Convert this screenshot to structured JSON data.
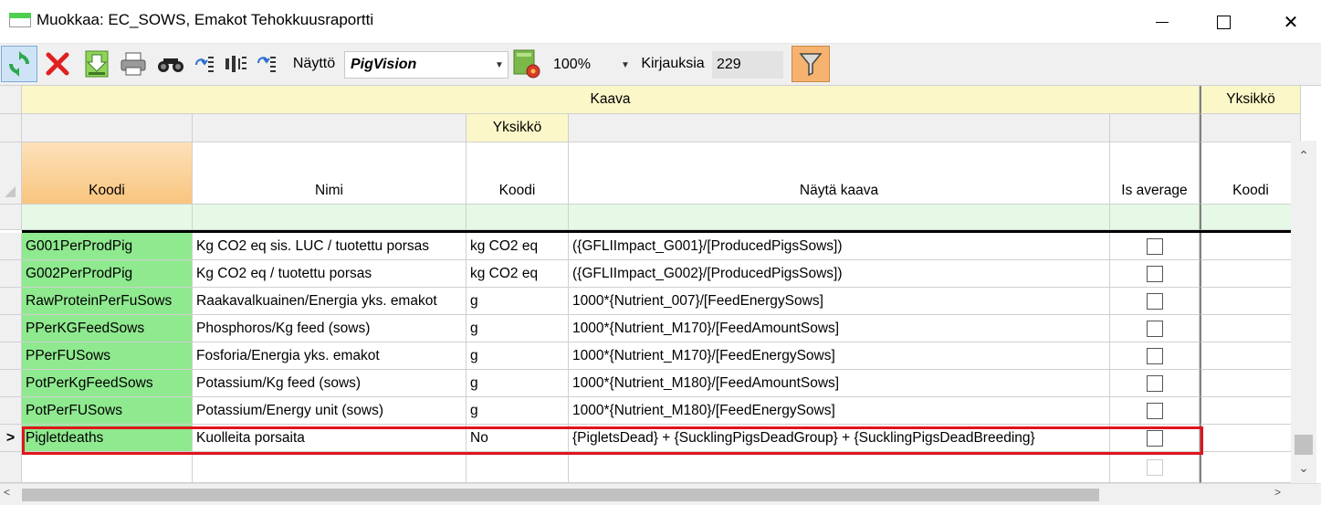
{
  "window": {
    "title": "Muokkaa: EC_SOWS, Emakot Tehokkuusraportti",
    "minimize": "—",
    "maximize": "☐",
    "close": "✕"
  },
  "toolbar": {
    "view_label": "Näyttö",
    "view_value": "PigVision",
    "zoom_value": "100%",
    "count_label": "Kirjauksia",
    "count_value": "229",
    "icons": [
      "refresh-icon",
      "delete-icon",
      "download-icon",
      "print-icon",
      "find-icon",
      "move-up-icon",
      "columns-icon",
      "move-down-icon",
      "settings-icon",
      "filter-icon"
    ]
  },
  "grid": {
    "group_header": "Kaava",
    "group_header_right": "Yksikkö",
    "sub_group_header": "Yksikkö",
    "columns": {
      "koodi": "Koodi",
      "nimi": "Nimi",
      "unit_koodi": "Koodi",
      "formula": "Näytä kaava",
      "is_average": "Is average",
      "right_koodi": "Koodi"
    },
    "current_row_marker": ">",
    "rows": [
      {
        "koodi": "G001PerProdPig",
        "nimi": "Kg CO2 eq sis. LUC / tuotettu porsas",
        "unit": "kg CO2 eq",
        "formula": "({GFLIImpact_G001}/[ProducedPigsSows])"
      },
      {
        "koodi": "G002PerProdPig",
        "nimi": "Kg CO2 eq / tuotettu porsas",
        "unit": "kg CO2 eq",
        "formula": "({GFLIImpact_G002}/[ProducedPigsSows])"
      },
      {
        "koodi": "RawProteinPerFuSows",
        "nimi": "Raakavalkuainen/Energia yks. emakot",
        "unit": "g",
        "formula": "1000*{Nutrient_007}/[FeedEnergySows]"
      },
      {
        "koodi": "PPerKGFeedSows",
        "nimi": "Phosphoros/Kg feed (sows)",
        "unit": "g",
        "formula": "1000*{Nutrient_M170}/[FeedAmountSows]"
      },
      {
        "koodi": "PPerFUSows",
        "nimi": "Fosforia/Energia yks. emakot",
        "unit": "g",
        "formula": "1000*{Nutrient_M170}/[FeedEnergySows]"
      },
      {
        "koodi": "PotPerKgFeedSows",
        "nimi": "Potassium/Kg feed (sows)",
        "unit": "g",
        "formula": "1000*{Nutrient_M180}/[FeedAmountSows]"
      },
      {
        "koodi": "PotPerFUSows",
        "nimi": "Potassium/Energy unit (sows)",
        "unit": "g",
        "formula": "1000*{Nutrient_M180}/[FeedEnergySows]"
      },
      {
        "koodi": "Pigletdeaths",
        "nimi": "Kuolleita porsaita",
        "unit": "No",
        "formula": "{PigletsDead} + {SucklingPigsDeadGroup} + {SucklingPigsDeadBreeding}"
      }
    ]
  },
  "colors": {
    "code_cell": "#8fe98f",
    "header_band": "#fbf7c8",
    "filter_row": "#e6f9e6",
    "highlight": "#e0141e",
    "koodi_header": "#f9c57f"
  }
}
